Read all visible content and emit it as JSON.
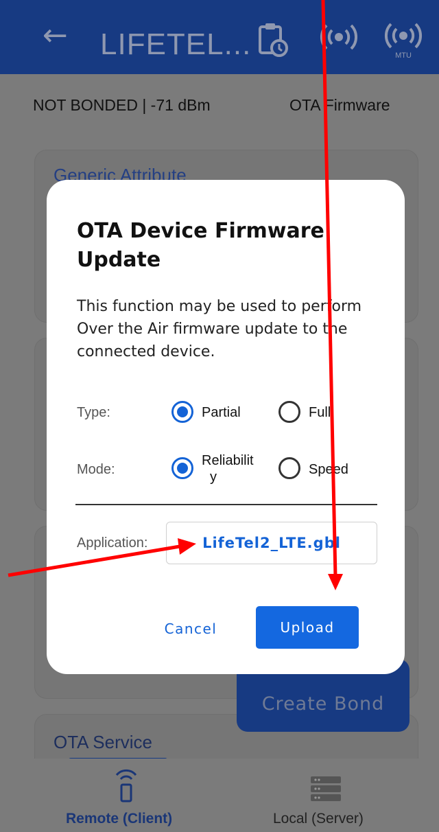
{
  "app": {
    "title": "LIFETEL...",
    "status_left": "NOT BONDED | -71 dBm",
    "status_right": "OTA Firmware",
    "bg_card_title": "Generic Attribute",
    "create_bond_label": "Create Bond",
    "ota_service_label": "OTA Service"
  },
  "icons": [
    "back-arrow-icon",
    "history-clipboard-icon",
    "signal-broadcast-icon",
    "mtu-broadcast-icon",
    "remote-client-icon",
    "local-server-icon"
  ],
  "dialog": {
    "title": "OTA Device Firmware Update",
    "description": "This function may be used to perform Over the Air firmware update to the connected device.",
    "type_label": "Type:",
    "type_options": [
      "Partial",
      "Full"
    ],
    "type_selected": "Partial",
    "mode_label": "Mode:",
    "mode_options": [
      "Reliability",
      "Speed"
    ],
    "mode_selected": "Reliability",
    "mode_option1_line1": "Reliabilit",
    "mode_option1_line2": "y",
    "application_label": "Application:",
    "application_value": "LifeTel2_LTE.gbl",
    "cancel_label": "Cancel",
    "upload_label": "Upload"
  },
  "bottom_nav": {
    "left_label": "Remote (Client)",
    "right_label": "Local (Server)"
  },
  "colors": {
    "accent": "#1463d6",
    "annotation": "#ff0000",
    "topbar": "#173a82"
  }
}
